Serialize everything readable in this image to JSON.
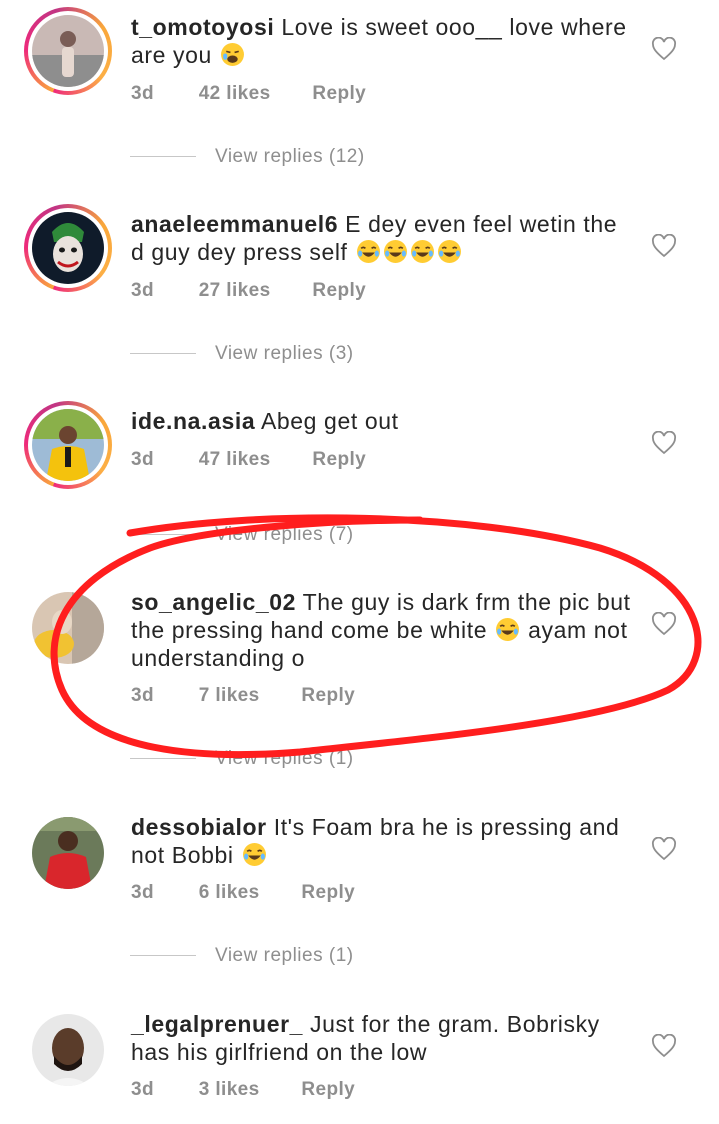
{
  "comments": [
    {
      "username": "t_omotoyosi",
      "text": "Love is sweet ooo__ love where are you",
      "emojis": [
        "weary-face-emoji"
      ],
      "time": "3d",
      "likes": "42 likes",
      "reply": "Reply",
      "view_replies": "View replies (12)",
      "avatar_colors": {
        "bg": "#c9b9b5",
        "accent": "#7a5d56"
      }
    },
    {
      "username": "anaeleemmanuel6",
      "text": "E dey even feel wetin the d guy dey press self",
      "emojis": [
        "laughing-emoji",
        "laughing-emoji",
        "laughing-emoji",
        "laughing-emoji"
      ],
      "time": "3d",
      "likes": "27 likes",
      "reply": "Reply",
      "view_replies": "View replies (3)",
      "avatar_colors": {
        "bg": "#0f1b2a",
        "accent": "#2f8a3a"
      }
    },
    {
      "username": "ide.na.asia",
      "text": "Abeg get out",
      "emojis": [],
      "time": "3d",
      "likes": "47 likes",
      "reply": "Reply",
      "view_replies": "View replies (7)",
      "avatar_colors": {
        "bg": "#9ebbd6",
        "accent": "#f4c20d"
      }
    },
    {
      "username": "so_angelic_02",
      "text_part1": "The guy is dark frm the pic but the pressing hand come be white",
      "text_part2": "ayam not understanding o",
      "emojis": [
        "laughing-emoji"
      ],
      "time": "3d",
      "likes": "7 likes",
      "reply": "Reply",
      "view_replies": "View replies (1)",
      "avatar_colors": {
        "bg": "#d9c6b3",
        "accent": "#f1c232"
      }
    },
    {
      "username": "dessobialor",
      "text": "It's Foam bra he is pressing and not Bobbi",
      "emojis": [
        "laughing-emoji"
      ],
      "time": "3d",
      "likes": "6 likes",
      "reply": "Reply",
      "view_replies": "View replies (1)",
      "avatar_colors": {
        "bg": "#6b7a5a",
        "accent": "#d9262c"
      }
    },
    {
      "username": "_legalprenuer_",
      "text": "Just for the gram. Bobrisky has his girlfriend on the low",
      "emojis": [],
      "time": "3d",
      "likes": "3 likes",
      "reply": "Reply",
      "avatar_colors": {
        "bg": "#e8e8e8",
        "accent": "#5a3c2a"
      }
    }
  ],
  "colors": {
    "annotation_red": "#ff1e1e",
    "meta_gray": "#8e8e8e",
    "story_ring": "#ee2a7b"
  }
}
